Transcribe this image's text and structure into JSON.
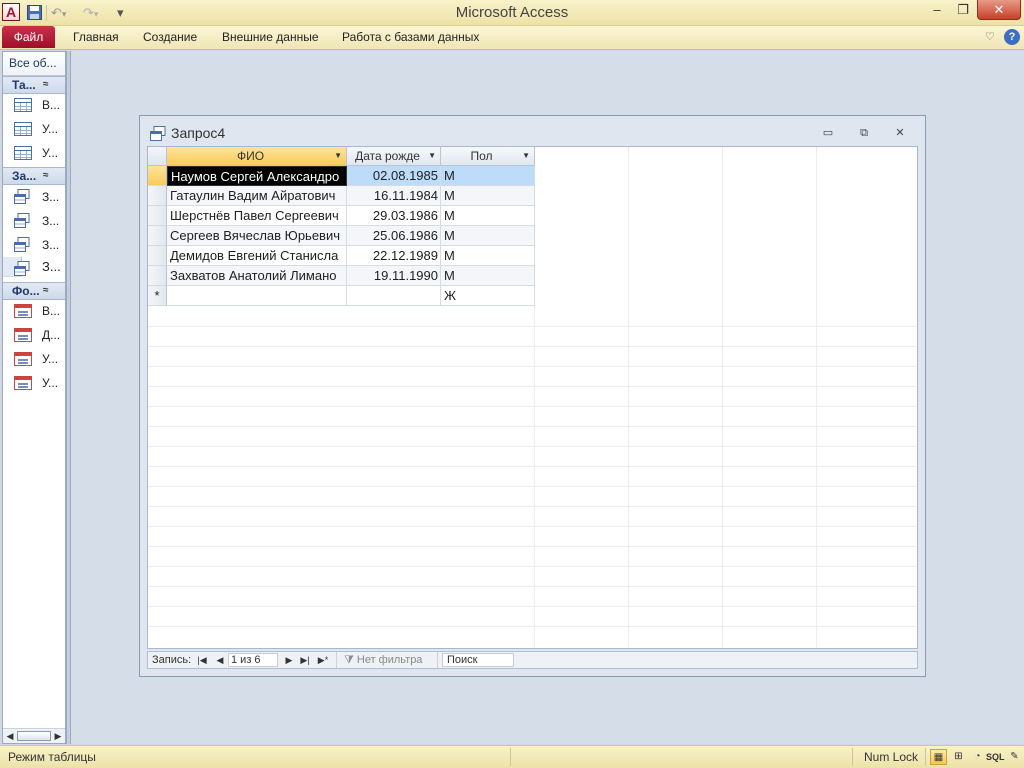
{
  "app": {
    "title": "Microsoft Access",
    "icon_letter": "A"
  },
  "quick_access": {
    "save": "save-icon",
    "undo": "↶",
    "undo_dd": "▾",
    "redo": "↷",
    "redo_dd": "▾",
    "customize": "▾"
  },
  "window_controls": {
    "minimize": "–",
    "maximize": "❐",
    "close": "✕"
  },
  "ribbon": {
    "file_tab": "Файл",
    "tabs": [
      "Главная",
      "Создание",
      "Внешние данные",
      "Работа с базами данных"
    ],
    "minimize": "♡",
    "help": "?"
  },
  "nav_pane": {
    "header": "Все об...",
    "groups": [
      {
        "title": "Та...",
        "chevron": "≈",
        "items": [
          {
            "label": "В...",
            "icon": "table-icon"
          },
          {
            "label": "У...",
            "icon": "table-icon"
          },
          {
            "label": "У...",
            "icon": "table-icon"
          }
        ]
      },
      {
        "title": "За...",
        "chevron": "≈",
        "items": [
          {
            "label": "З...",
            "icon": "query-icon"
          },
          {
            "label": "З...",
            "icon": "query-icon"
          },
          {
            "label": "З...",
            "icon": "query-icon"
          },
          {
            "label": "З...",
            "icon": "query-icon",
            "selected": true
          }
        ]
      },
      {
        "title": "Фо...",
        "chevron": "≈",
        "items": [
          {
            "label": "В...",
            "icon": "form-icon"
          },
          {
            "label": "Д...",
            "icon": "form-icon"
          },
          {
            "label": "У...",
            "icon": "form-icon"
          },
          {
            "label": "У...",
            "icon": "form-icon"
          }
        ]
      }
    ],
    "scroll_left": "◀",
    "scroll_right": "▶"
  },
  "query_window": {
    "title": "Запрос4",
    "controls": {
      "minimize": "▭",
      "restore": "⧉",
      "close": "✕"
    },
    "columns": [
      {
        "label": "ФИО",
        "dropdown": "▼"
      },
      {
        "label": "Дата рожде",
        "dropdown": "▼"
      },
      {
        "label": "Пол",
        "dropdown": "▼"
      }
    ],
    "rows": [
      {
        "fio": "Наумов Сергей Александро",
        "birth": "02.08.1985",
        "sex": "М"
      },
      {
        "fio": "Гатаулин Вадим Айратович",
        "birth": "16.11.1984",
        "sex": "М"
      },
      {
        "fio": "Шерстнёв Павел Сергеевич",
        "birth": "29.03.1986",
        "sex": "М"
      },
      {
        "fio": "Сергеев Вячеслав Юрьевич",
        "birth": "25.06.1986",
        "sex": "М"
      },
      {
        "fio": "Демидов Евгений Станисла",
        "birth": "22.12.1989",
        "sex": "М"
      },
      {
        "fio": "Захватов Анатолий Лимано",
        "birth": "19.11.1990",
        "sex": "М"
      }
    ],
    "new_row": {
      "marker": "*",
      "fio": "",
      "birth": "",
      "sex": "Ж"
    },
    "record_nav": {
      "label": "Запись:",
      "first": "|◀",
      "prev": "◀",
      "position": "1 из 6",
      "next": "▶",
      "last": "▶|",
      "new": "▶*",
      "filter": "Нет фильтра",
      "filter_icon": "⧩",
      "search_placeholder": "Поиск"
    }
  },
  "status_bar": {
    "text": "Режим таблицы",
    "numlock": "Num Lock",
    "views": {
      "datasheet": "▦",
      "pivot": "⊞",
      "chart": "◔",
      "sql": "SQL",
      "design": "✎"
    }
  }
}
